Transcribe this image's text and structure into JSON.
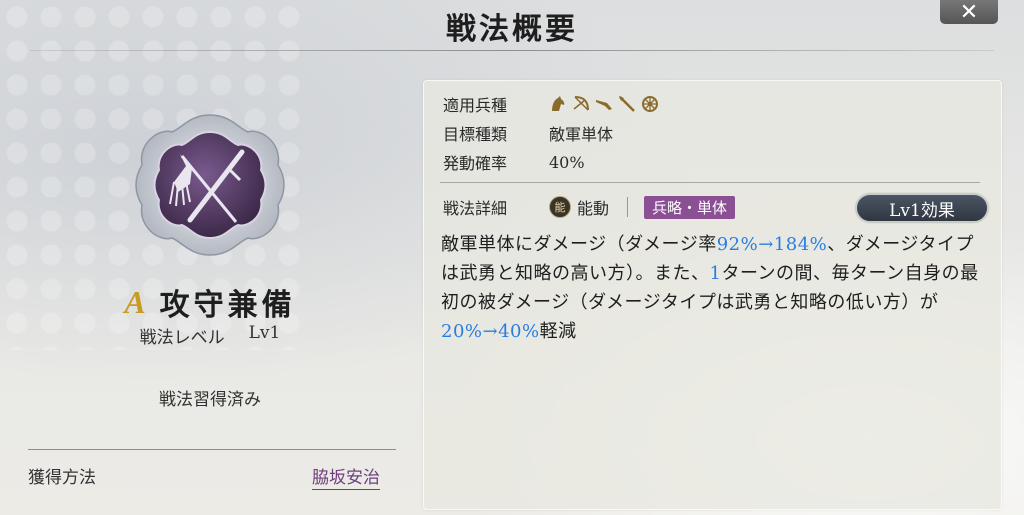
{
  "header": {
    "title": "戦法概要",
    "close_label": "✕"
  },
  "skill": {
    "grade": "A",
    "name": "攻守兼備",
    "level_label": "戦法レベル",
    "level_value": "Lv1",
    "status": "戦法習得済み",
    "acquire_label": "獲得方法",
    "acquire_value": "脇坂安治",
    "emblem_icon": "sword-and-whisk-icon"
  },
  "info": {
    "troop_label": "適用兵種",
    "troop_icons": [
      "cavalry-icon",
      "bow-icon",
      "gun-icon",
      "spear-icon",
      "wheel-icon"
    ],
    "target_label": "目標種類",
    "target_value": "敵軍単体",
    "rate_label": "発動確率",
    "rate_value": "40%",
    "detail_label": "戦法詳細",
    "active_badge": "能",
    "active_label": "能動",
    "tag": "兵略・単体",
    "effect_button": "Lv1効果"
  },
  "description": {
    "p1": "敵軍単体にダメージ（ダメージ率",
    "v1": "92%→184%",
    "p2": "、ダメージタイプは武勇と知略の高い方）。また、",
    "v2": "1",
    "p3": "ターンの間、毎ターン自身の最初の被ダメージ（ダメージタイプは武勇と知略の低い方）が",
    "v3": "20%→40%",
    "p4": "軽減"
  },
  "colors": {
    "tag": "#8b4f93",
    "value_blue": "#2a7de0",
    "grade": "#c89b23"
  }
}
